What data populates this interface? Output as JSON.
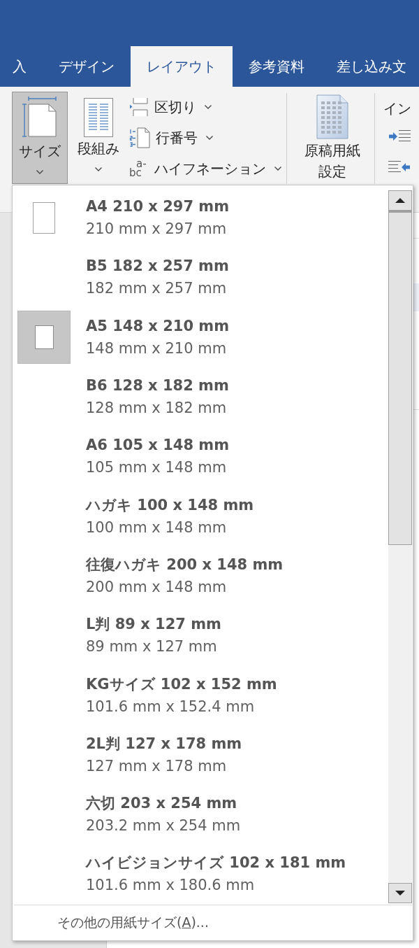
{
  "tabs": [
    {
      "label": "入",
      "selected": false
    },
    {
      "label": "デザイン",
      "selected": false
    },
    {
      "label": "レイアウト",
      "selected": true
    },
    {
      "label": "参考資料",
      "selected": false
    },
    {
      "label": "差し込み文",
      "selected": false
    }
  ],
  "ribbon": {
    "size_button": {
      "label": "サイズ",
      "expanded": true
    },
    "columns_button": {
      "label": "段組み",
      "expanded": false
    },
    "breaks_button": {
      "label": "区切り",
      "expanded": false
    },
    "line_numbers_button": {
      "label": "行番号",
      "expanded": false
    },
    "hyphenation_button": {
      "label": "ハイフネーション",
      "icon_text": [
        "a-",
        "bc"
      ],
      "expanded": false
    },
    "manuscript_button": {
      "label": "原稿用紙設定"
    },
    "indent_heading": "イン"
  },
  "paper_size_menu": {
    "items": [
      {
        "name": "A4 210 x 297 mm",
        "size": "210 mm x 297 mm",
        "selected": false,
        "show_icon": true
      },
      {
        "name": "B5 182 x 257 mm",
        "size": "182 mm x 257 mm",
        "selected": false,
        "show_icon": false
      },
      {
        "name": "A5 148 x 210 mm",
        "size": "148 mm x 210 mm",
        "selected": true,
        "show_icon": true
      },
      {
        "name": "B6 128 x 182 mm",
        "size": "128 mm x 182 mm",
        "selected": false,
        "show_icon": false
      },
      {
        "name": "A6 105 x 148 mm",
        "size": "105 mm x 148 mm",
        "selected": false,
        "show_icon": false
      },
      {
        "name": "ハガキ 100 x 148 mm",
        "size": "100 mm x 148 mm",
        "selected": false,
        "show_icon": false
      },
      {
        "name": "往復ハガキ 200 x 148 mm",
        "size": "200 mm x 148 mm",
        "selected": false,
        "show_icon": false
      },
      {
        "name": "L判 89 x 127 mm",
        "size": "89 mm x 127 mm",
        "selected": false,
        "show_icon": false
      },
      {
        "name": "KGサイズ 102 x 152 mm",
        "size": "101.6 mm x 152.4 mm",
        "selected": false,
        "show_icon": false
      },
      {
        "name": "2L判 127 x 178 mm",
        "size": "127 mm x 178 mm",
        "selected": false,
        "show_icon": false
      },
      {
        "name": "六切 203 x 254 mm",
        "size": "203.2 mm x 254 mm",
        "selected": false,
        "show_icon": false
      },
      {
        "name": "ハイビジョンサイズ 102 x 181 mm",
        "size": "101.6 mm x 180.6 mm",
        "selected": false,
        "show_icon": false
      }
    ],
    "more_sizes": {
      "text_before": "その他の用紙サイズ(",
      "access_key": "A",
      "text_after": ")..."
    }
  }
}
